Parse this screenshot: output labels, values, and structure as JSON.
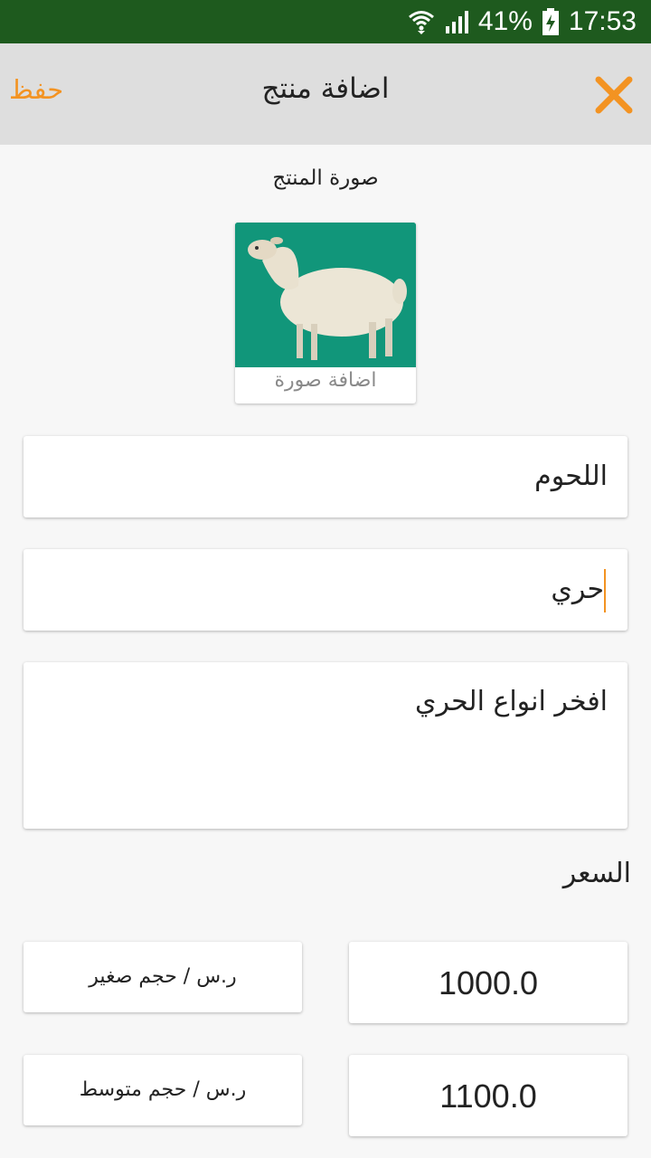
{
  "status_bar": {
    "battery": "41%",
    "time": "17:53",
    "bg_color": "#1e5a1e",
    "icons": [
      "wifi-icon",
      "signal-icon",
      "battery-charging-icon"
    ]
  },
  "app_bar": {
    "title": "اضافة منتج",
    "save_label": "حفظ",
    "close_icon": "close-icon",
    "accent_color": "#f39322",
    "bg_color": "#dedede"
  },
  "product_image": {
    "section_label": "صورة المنتج",
    "add_photo_label": "اضافة صورة",
    "image_icon": "sheep-photo"
  },
  "form": {
    "category_value": "اللحوم",
    "name_value": "حري",
    "description_value": "افخر انواع الحري"
  },
  "price": {
    "heading": "السعر",
    "rows": [
      {
        "value": "1000.0",
        "label": "ر.س / حجم صغير"
      },
      {
        "value": "1100.0",
        "label": "ر.س / حجم متوسط"
      }
    ]
  }
}
